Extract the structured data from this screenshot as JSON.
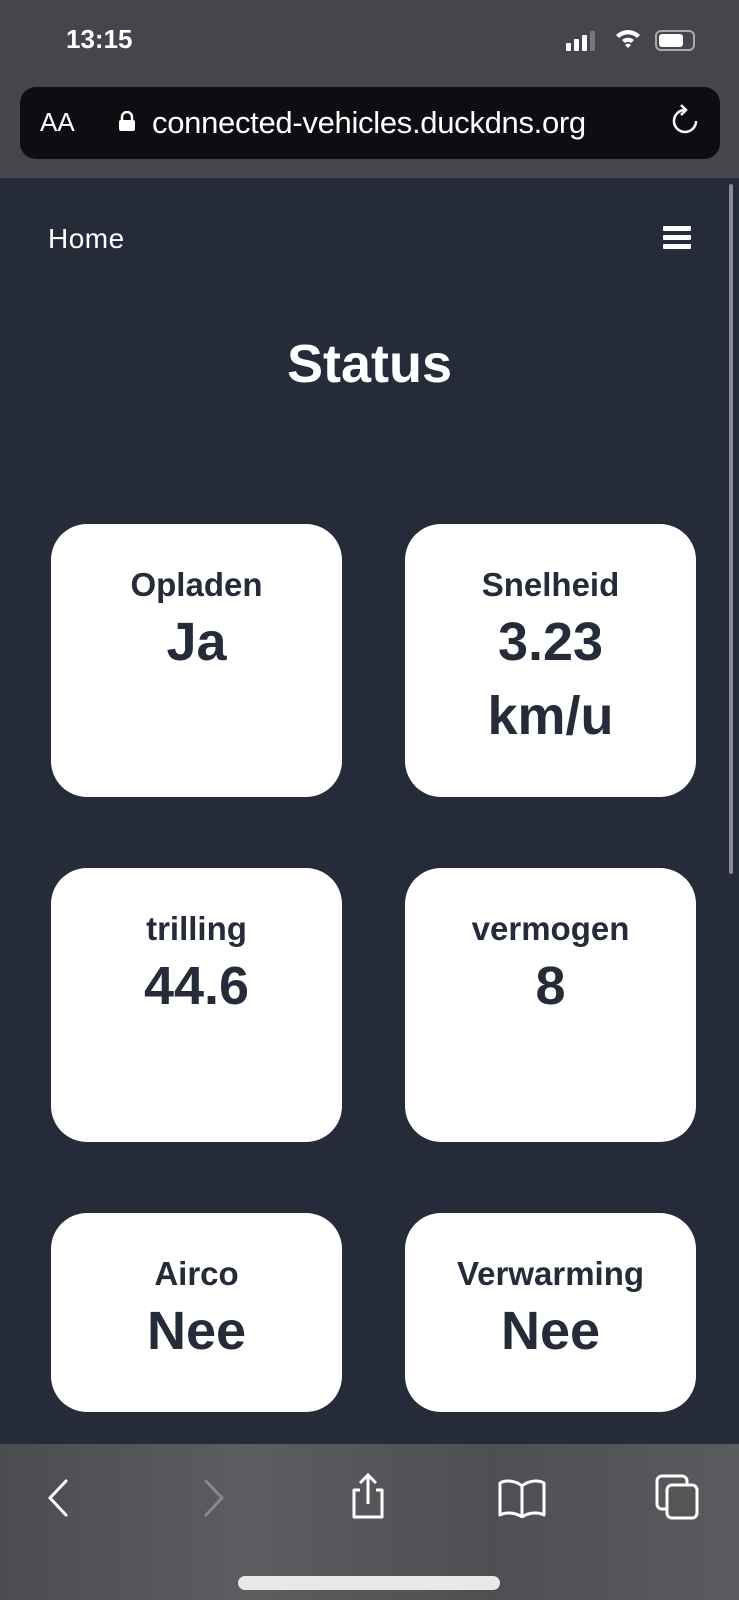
{
  "status_bar": {
    "time": "13:15"
  },
  "browser": {
    "text_size_label": "AA",
    "url": "connected-vehicles.duckdns.org"
  },
  "nav": {
    "home": "Home"
  },
  "page": {
    "title": "Status"
  },
  "cards": [
    {
      "label": "Opladen",
      "value": "Ja"
    },
    {
      "label": "Snelheid",
      "value": "3.23",
      "unit": "km/u"
    },
    {
      "label": "trilling",
      "value": "44.6"
    },
    {
      "label": "vermogen",
      "value": "8"
    },
    {
      "label": "Airco",
      "value": "Nee"
    },
    {
      "label": "Verwarming",
      "value": "Nee"
    }
  ],
  "colors": {
    "page_bg": "#262b3a",
    "card_bg": "#ffffff",
    "card_text": "#262b3a"
  }
}
